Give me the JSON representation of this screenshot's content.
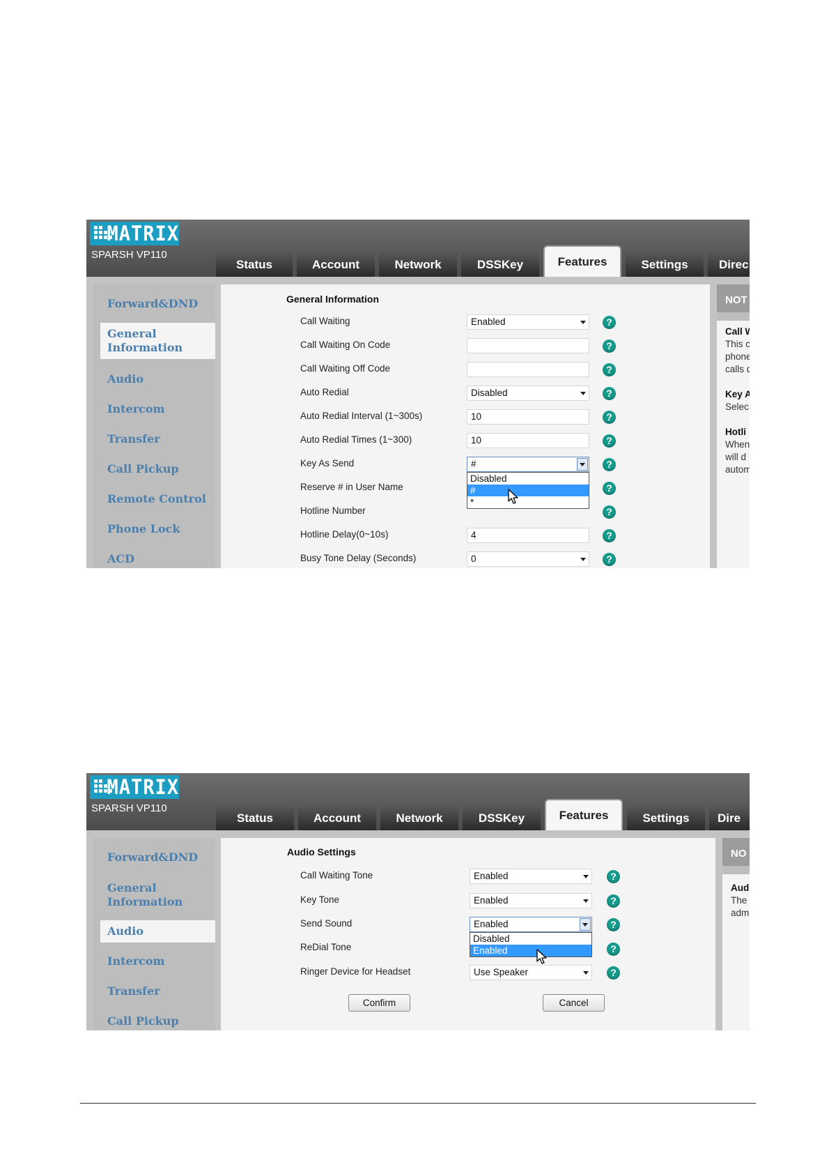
{
  "brand": {
    "logo_text": "MATRIX",
    "model": "SPARSH VP110"
  },
  "tabs": [
    "Status",
    "Account",
    "Network",
    "DSSKey",
    "Features",
    "Settings",
    "Direc"
  ],
  "tabs_bottom": [
    "Status",
    "Account",
    "Network",
    "DSSKey",
    "Features",
    "Settings",
    "Dire"
  ],
  "active_tab": "Features",
  "screen1": {
    "sidebar": [
      "Forward&DND",
      "General Information",
      "Audio",
      "Intercom",
      "Transfer",
      "Call Pickup",
      "Remote Control",
      "Phone Lock",
      "ACD"
    ],
    "active_sidebar": "General Information",
    "section_title": "General Information",
    "rows": [
      {
        "label": "Call Waiting",
        "value": "Enabled",
        "type": "select"
      },
      {
        "label": "Call Waiting On Code",
        "value": "",
        "type": "input"
      },
      {
        "label": "Call Waiting Off Code",
        "value": "",
        "type": "input"
      },
      {
        "label": "Auto Redial",
        "value": "Disabled",
        "type": "select"
      },
      {
        "label": "Auto Redial Interval (1~300s)",
        "value": "10",
        "type": "input"
      },
      {
        "label": "Auto Redial Times (1~300)",
        "value": "10",
        "type": "input"
      },
      {
        "label": "Key As Send",
        "value": "#",
        "type": "select-open"
      },
      {
        "label": "Reserve # in User Name",
        "value": "",
        "type": "hidden"
      },
      {
        "label": "Hotline Number",
        "value": "",
        "type": "hidden"
      },
      {
        "label": "Hotline Delay(0~10s)",
        "value": "4",
        "type": "input"
      },
      {
        "label": "Busy Tone Delay (Seconds)",
        "value": "0",
        "type": "select"
      }
    ],
    "dropdown_options": [
      "Disabled",
      "#",
      "*"
    ],
    "dropdown_selected": "#",
    "notes": {
      "header": "NOT",
      "lines": [
        "Call W",
        "This c",
        "phone",
        "calls d",
        "Key A",
        "Selec",
        "Hotli",
        "When",
        "will d",
        "autom"
      ]
    }
  },
  "screen2": {
    "sidebar": [
      "Forward&DND",
      "General Information",
      "Audio",
      "Intercom",
      "Transfer",
      "Call Pickup"
    ],
    "active_sidebar": "Audio",
    "section_title": "Audio Settings",
    "rows": [
      {
        "label": "Call Waiting Tone",
        "value": "Enabled",
        "type": "select"
      },
      {
        "label": "Key Tone",
        "value": "Enabled",
        "type": "select"
      },
      {
        "label": "Send Sound",
        "value": "Enabled",
        "type": "select-open"
      },
      {
        "label": "ReDial Tone",
        "value": "",
        "type": "hidden"
      },
      {
        "label": "Ringer Device for Headset",
        "value": "Use Speaker",
        "type": "select"
      }
    ],
    "dropdown_options": [
      "Disabled",
      "Enabled"
    ],
    "dropdown_selected": "Enabled",
    "buttons": {
      "confirm": "Confirm",
      "cancel": "Cancel"
    },
    "notes": {
      "header": "NO",
      "lines": [
        "Aud",
        "The",
        "adm"
      ]
    }
  },
  "help_glyph": "?",
  "colors": {
    "brand": "#1c9ec3",
    "help": "#159a8c",
    "link": "#4a7fae",
    "selection": "#3399ff"
  }
}
